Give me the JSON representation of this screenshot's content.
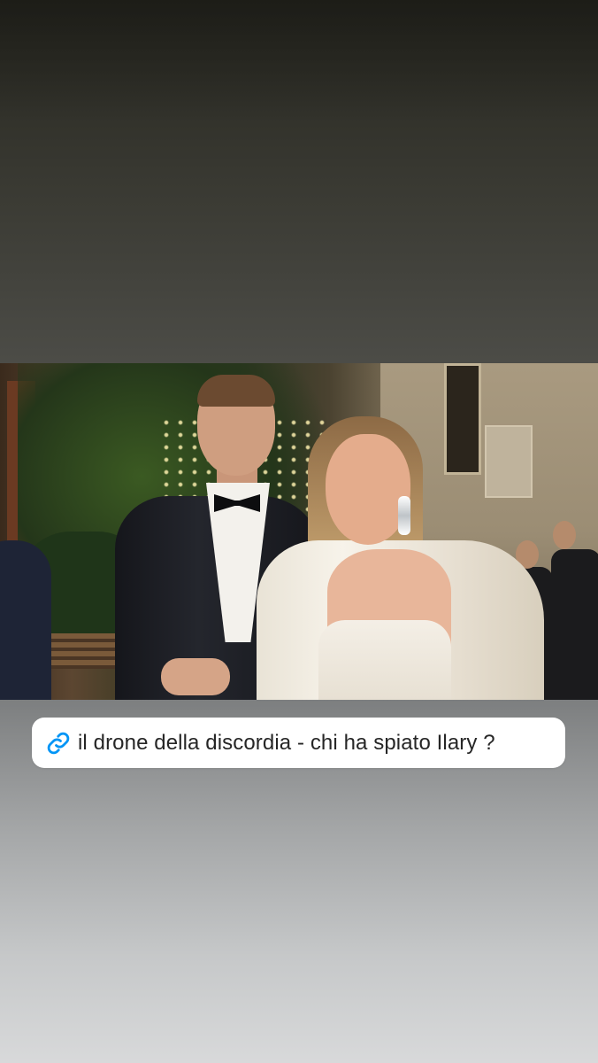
{
  "story": {
    "link_sticker": {
      "icon": "link-icon",
      "icon_color": "#0095f6",
      "text": "il drone della discordia - chi ha spiato Ilary ?"
    },
    "background_gradient": [
      "#26261f",
      "#555553",
      "#d8d9da"
    ]
  }
}
